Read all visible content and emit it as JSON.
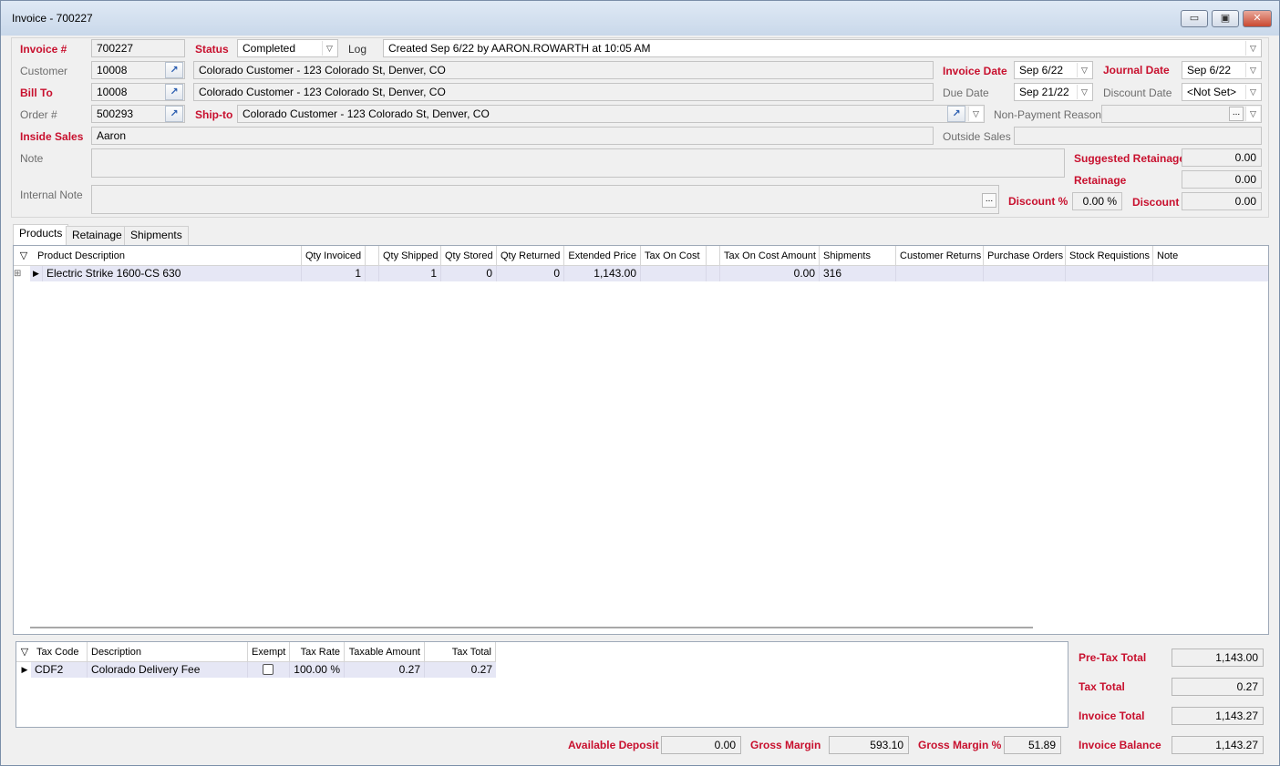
{
  "window": {
    "title": "Invoice - 700227",
    "minimize": "▭",
    "maximize": "▣",
    "close": "✕"
  },
  "header": {
    "invoice_label": "Invoice #",
    "invoice_value": "700227",
    "status_label": "Status",
    "status_value": "Completed",
    "log_label": "Log",
    "log_value": "Created Sep 6/22 by AARON.ROWARTH at 10:05 AM",
    "customer_label": "Customer",
    "customer_id": "10008",
    "customer_name": "Colorado Customer - 123 Colorado St, Denver, CO",
    "invoice_date_label": "Invoice Date",
    "invoice_date": "Sep 6/22",
    "journal_date_label": "Journal Date",
    "journal_date": "Sep 6/22",
    "bill_to_label": "Bill To",
    "bill_to_id": "10008",
    "bill_to_name": "Colorado Customer - 123 Colorado St, Denver, CO",
    "due_date_label": "Due Date",
    "due_date": "Sep 21/22",
    "discount_date_label": "Discount Date",
    "discount_date": "<Not Set>",
    "order_label": "Order #",
    "order_value": "500293",
    "ship_to_label": "Ship-to",
    "ship_to_value": "Colorado Customer - 123 Colorado St, Denver, CO",
    "non_payment_label": "Non-Payment Reason",
    "non_payment_value": "",
    "inside_sales_label": "Inside Sales",
    "inside_sales_value": "Aaron",
    "outside_sales_label": "Outside Sales",
    "outside_sales_value": "",
    "note_label": "Note",
    "note_value": "",
    "internal_note_label": "Internal Note",
    "internal_note_value": "",
    "suggested_retainage_label": "Suggested Retainage",
    "suggested_retainage_value": "0.00",
    "retainage_label": "Retainage",
    "retainage_value": "0.00",
    "discount_pct_label": "Discount %",
    "discount_pct_value": "0.00 %",
    "discount_label": "Discount",
    "discount_value": "0.00"
  },
  "tabs": [
    {
      "label": "Products"
    },
    {
      "label": "Retainage"
    },
    {
      "label": "Shipments"
    }
  ],
  "products": {
    "columns": [
      "Product Description",
      "Qty Invoiced",
      "Qty Shipped",
      "Qty Stored",
      "Qty Returned",
      "Extended Price",
      "Tax On Cost",
      "Tax On Cost Amount",
      "Shipments",
      "Customer Returns",
      "Purchase Orders",
      "Stock Requistions",
      "Note"
    ],
    "rows": [
      {
        "description": "Electric Strike 1600-CS 630",
        "qty_invoiced": "1",
        "qty_shipped": "1",
        "qty_stored": "0",
        "qty_returned": "0",
        "extended_price": "1,143.00",
        "tax_on_cost": "",
        "tax_on_cost_amount": "0.00",
        "shipments": "316",
        "customer_returns": "",
        "purchase_orders": "",
        "stock_requisitions": "",
        "note": ""
      }
    ]
  },
  "taxes": {
    "columns": [
      "Tax Code",
      "Description",
      "Exempt",
      "Tax Rate",
      "Taxable Amount",
      "Tax Total"
    ],
    "rows": [
      {
        "code": "CDF2",
        "description": "Colorado Delivery Fee",
        "exempt": false,
        "rate": "100.00 %",
        "taxable": "0.27",
        "total": "0.27"
      }
    ]
  },
  "totals": {
    "available_deposit_label": "Available Deposit",
    "available_deposit": "0.00",
    "gross_margin_label": "Gross Margin",
    "gross_margin": "593.10",
    "gross_margin_pct_label": "Gross Margin %",
    "gross_margin_pct": "51.89",
    "pretax_label": "Pre-Tax Total",
    "pretax": "1,143.00",
    "tax_total_label": "Tax Total",
    "tax_total": "0.27",
    "invoice_total_label": "Invoice Total",
    "invoice_total": "1,143.27",
    "invoice_balance_label": "Invoice Balance",
    "invoice_balance": "1,143.27"
  }
}
